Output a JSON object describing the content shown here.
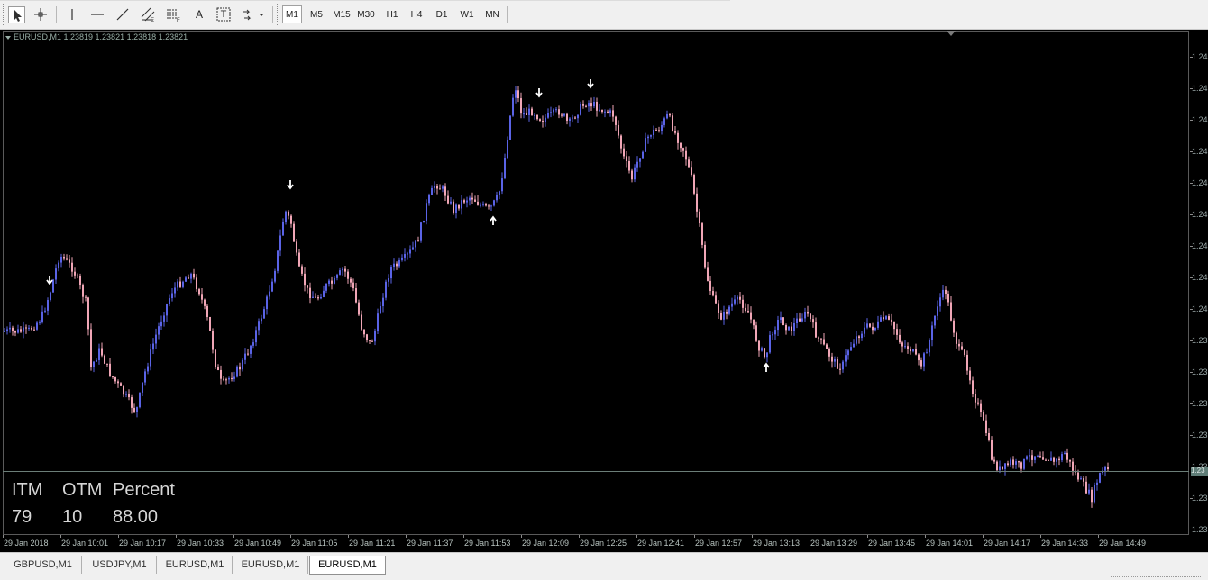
{
  "toolbar": {
    "tools": [
      {
        "name": "cursor-icon"
      },
      {
        "name": "crosshair-icon"
      },
      {
        "name": "vertical-line-icon"
      },
      {
        "name": "horizontal-line-icon"
      },
      {
        "name": "trendline-icon"
      },
      {
        "name": "equidistant-channel-icon"
      },
      {
        "name": "fibonacci-icon"
      },
      {
        "name": "text-icon",
        "label": "A"
      },
      {
        "name": "text-label-icon",
        "label": "T"
      },
      {
        "name": "arrows-dropdown-icon"
      }
    ],
    "timeframes": [
      "M1",
      "M5",
      "M15",
      "M30",
      "H1",
      "H4",
      "D1",
      "W1",
      "MN"
    ],
    "active_timeframe": "M1"
  },
  "chart": {
    "symbol_line": "EURUSD,M1  1.23819 1.23821 1.23818 1.23821",
    "bid_label": "1.23",
    "up_color": "#5a63e6",
    "down_color": "#f0a6b6",
    "background": "#000000",
    "price_labels": [
      "1.24",
      "1.24",
      "1.24",
      "1.24",
      "1.24",
      "1.24",
      "1.24",
      "1.24",
      "1.24",
      "1.23",
      "1.23",
      "1.23",
      "1.23",
      "1.23",
      "1.23",
      "1.23"
    ],
    "time_labels": [
      "29 Jan 2018",
      "29 Jan 10:01",
      "29 Jan 10:17",
      "29 Jan 10:33",
      "29 Jan 10:49",
      "29 Jan 11:05",
      "29 Jan 11:21",
      "29 Jan 11:37",
      "29 Jan 11:53",
      "29 Jan 12:09",
      "29 Jan 12:25",
      "29 Jan 12:41",
      "29 Jan 12:57",
      "29 Jan 13:13",
      "29 Jan 13:29",
      "29 Jan 13:45",
      "29 Jan 14:01",
      "29 Jan 14:17",
      "29 Jan 14:33",
      "29 Jan 14:49"
    ],
    "stats": {
      "headers": [
        "ITM",
        "OTM",
        "Percent"
      ],
      "values": [
        "79",
        "10",
        "88.00"
      ]
    }
  },
  "tabs": [
    "GBPUSD,M1",
    "USDJPY,M1",
    "EURUSD,M1",
    "EURUSD,M1",
    "EURUSD,M1"
  ],
  "active_tab": 4
}
